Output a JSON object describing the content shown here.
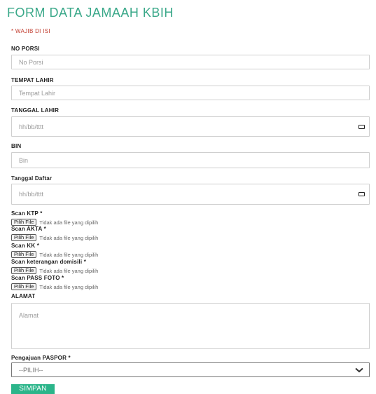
{
  "form": {
    "title": "FORM DATA JAMAAH KBIH",
    "required_note": "* WAJIB DI ISI",
    "fields": {
      "no_porsi": {
        "label": "NO PORSI",
        "placeholder": "No Porsi"
      },
      "tempat_lahir": {
        "label": "TEMPAT LAHIR",
        "placeholder": "Tempat Lahir"
      },
      "tanggal_lahir": {
        "label": "TANGGAL LAHIR",
        "placeholder": "hh/bb/tttt"
      },
      "bin": {
        "label": "BIN",
        "placeholder": "Bin"
      },
      "tanggal_daftar": {
        "label": "Tanggal Daftar",
        "placeholder": "hh/bb/tttt"
      },
      "alamat": {
        "label": "ALAMAT",
        "placeholder": "Alamat"
      },
      "paspor": {
        "label": "Pengajuan PASPOR *",
        "selected": "--PILIH--"
      }
    },
    "uploads": [
      {
        "label": "Scan KTP *",
        "button": "Pilih File",
        "status": "Tidak ada file yang dipilih"
      },
      {
        "label": "Scan AKTA *",
        "button": "Pilih File",
        "status": "Tidak ada file yang dipilih"
      },
      {
        "label": "Scan KK *",
        "button": "Pilih File",
        "status": "Tidak ada file yang dipilih"
      },
      {
        "label": "Scan keterangan domisili *",
        "button": "Pilih File",
        "status": "Tidak ada file yang dipilih"
      },
      {
        "label": "Scan PASS FOTO *",
        "button": "Pilih File",
        "status": "Tidak ada file yang dipilih"
      }
    ],
    "submit_label": "SIMPAN"
  },
  "colors": {
    "title": "#3aa889",
    "required": "#c0392b",
    "submit_bg": "#2bb58a"
  }
}
